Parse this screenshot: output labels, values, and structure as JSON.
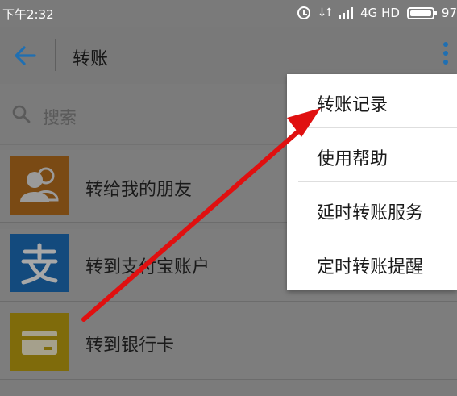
{
  "status_bar": {
    "time": "下午2:32",
    "network": "4G HD",
    "battery_text": "97"
  },
  "header": {
    "title": "转账",
    "accent_color": "#1f6fb2"
  },
  "search": {
    "placeholder": "搜索"
  },
  "list": {
    "items": [
      {
        "label": "转给我的朋友",
        "icon": "friends-icon",
        "color": "#e07a18"
      },
      {
        "label": "转到支付宝账户",
        "icon": "alipay-icon",
        "color": "#1677d2"
      },
      {
        "label": "转到银行卡",
        "icon": "bank-card-icon",
        "color": "#e4b600"
      }
    ]
  },
  "menu": {
    "items": [
      {
        "label": "转账记录"
      },
      {
        "label": "使用帮助"
      },
      {
        "label": "延时转账服务"
      },
      {
        "label": "定时转账提醒"
      }
    ]
  },
  "annotation": {
    "color": "#e01010"
  }
}
